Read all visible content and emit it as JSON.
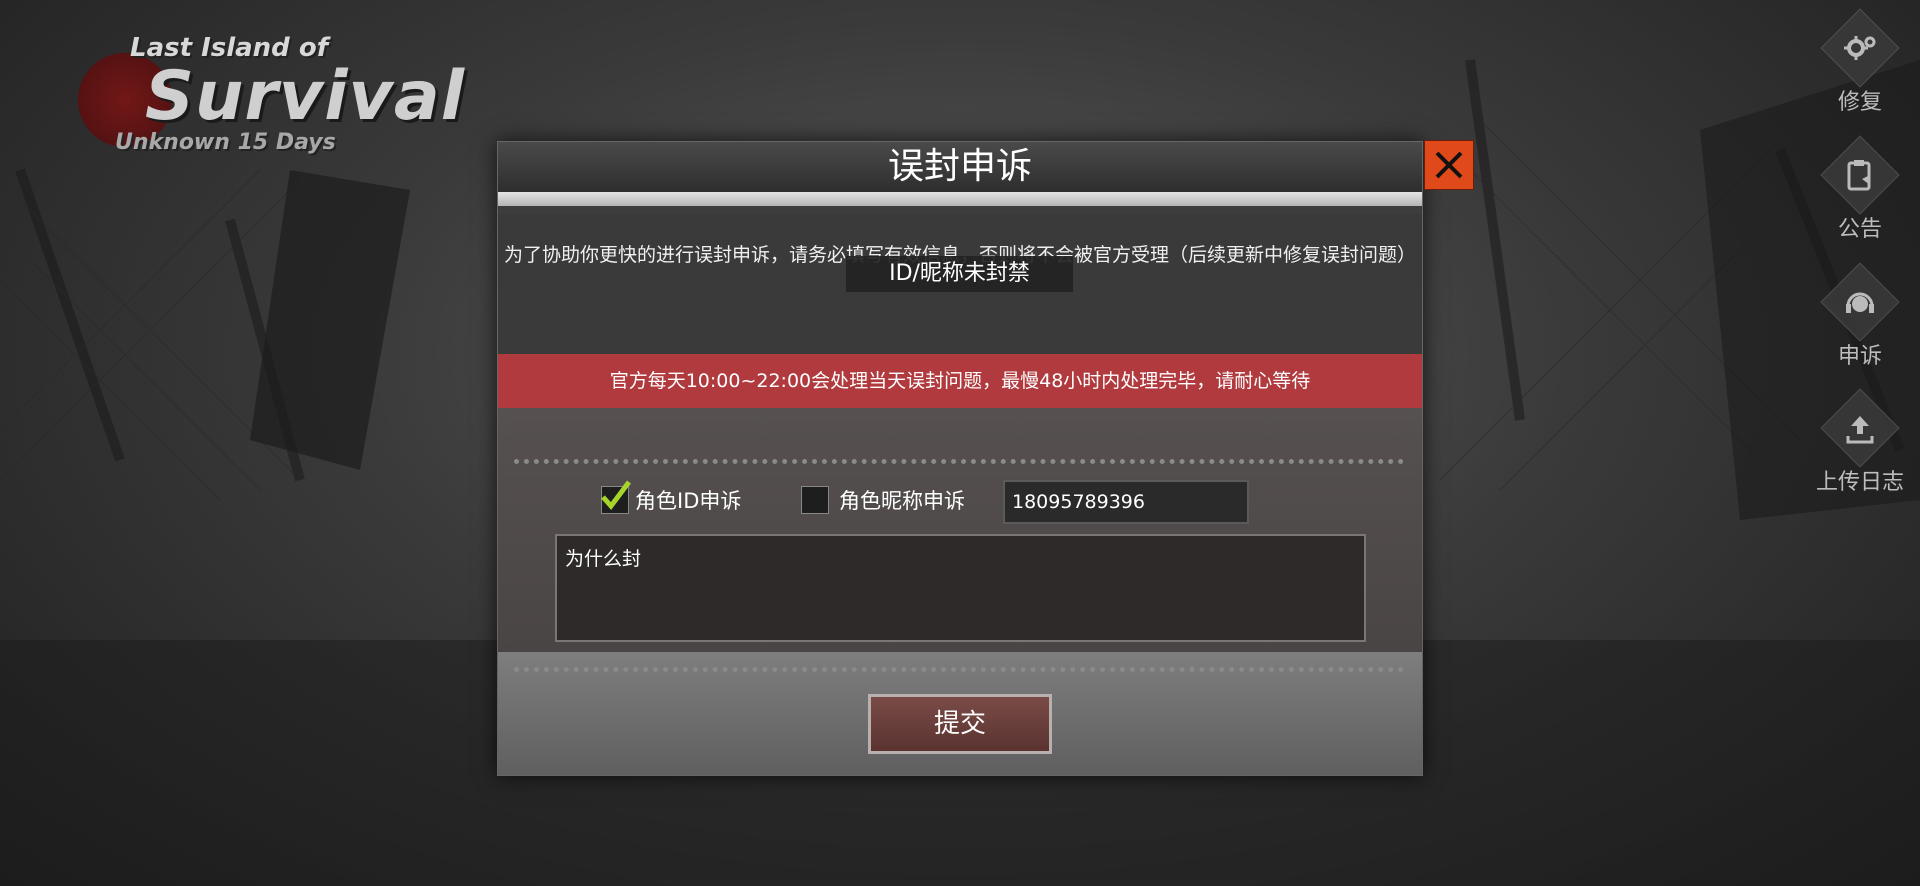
{
  "logo": {
    "line1": "Last Island of",
    "line2": "Survival",
    "line3": "Unknown 15 Days"
  },
  "side_menu": [
    {
      "label": "修复",
      "icon": "gear-icon"
    },
    {
      "label": "公告",
      "icon": "announcement-icon"
    },
    {
      "label": "申诉",
      "icon": "support-headset-icon"
    },
    {
      "label": "上传日志",
      "icon": "upload-icon"
    }
  ],
  "dialog": {
    "title": "误封申诉",
    "notice": "为了协助你更快的进行误封申诉，请务必填写有效信息，否则将不会被官方受理（后续更新中修复误封问题）",
    "toast": "ID/昵称未封禁",
    "warning": "官方每天10:00~22:00会处理当天误封问题，最慢48小时内处理完毕，请耐心等待",
    "option_id_label": "角色ID申诉",
    "option_id_checked": true,
    "option_nick_label": "角色昵称申诉",
    "option_nick_checked": false,
    "id_value": "18095789396",
    "reason_value": "为什么封",
    "submit_label": "提交"
  },
  "colors": {
    "warning_bar": "#b13a3e",
    "close_button": "#e04a1a",
    "checkmark": "#a6d42a"
  }
}
